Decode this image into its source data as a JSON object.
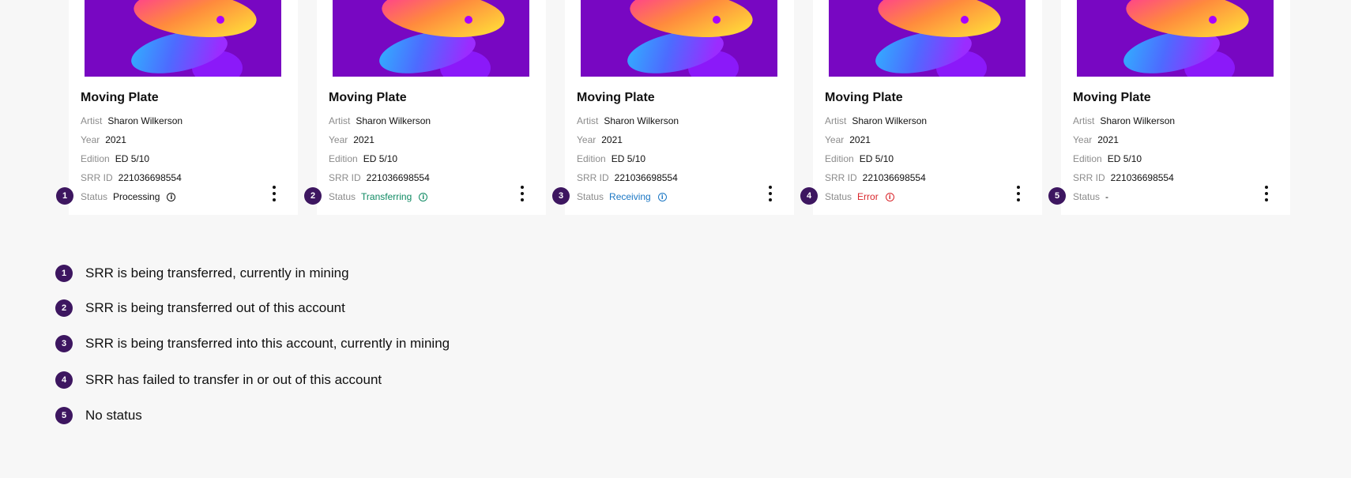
{
  "colors": {
    "background": "#f7f7f7",
    "card": "#ffffff",
    "badge": "#3d1660",
    "processing": "#111111",
    "transferring": "#0f8a63",
    "receiving": "#1b77c4",
    "error": "#d9262b",
    "none": "#111111"
  },
  "labels": {
    "artist": "Artist",
    "year": "Year",
    "edition": "Edition",
    "srr_id": "SRR ID",
    "status": "Status"
  },
  "cards": [
    {
      "badge": "1",
      "title": "Moving Plate",
      "artist": "Sharon Wilkerson",
      "year": "2021",
      "edition": "ED 5/10",
      "srr_id": "221036698554",
      "status": "Processing",
      "status_color": "#111111",
      "info_icon": true
    },
    {
      "badge": "2",
      "title": "Moving Plate",
      "artist": "Sharon Wilkerson",
      "year": "2021",
      "edition": "ED 5/10",
      "srr_id": "221036698554",
      "status": "Transferring",
      "status_color": "#0f8a63",
      "info_icon": true
    },
    {
      "badge": "3",
      "title": "Moving Plate",
      "artist": "Sharon Wilkerson",
      "year": "2021",
      "edition": "ED 5/10",
      "srr_id": "221036698554",
      "status": "Receiving",
      "status_color": "#1b77c4",
      "info_icon": true
    },
    {
      "badge": "4",
      "title": "Moving Plate",
      "artist": "Sharon Wilkerson",
      "year": "2021",
      "edition": "ED 5/10",
      "srr_id": "221036698554",
      "status": "Error",
      "status_color": "#d9262b",
      "info_icon": true
    },
    {
      "badge": "5",
      "title": "Moving Plate",
      "artist": "Sharon Wilkerson",
      "year": "2021",
      "edition": "ED 5/10",
      "srr_id": "221036698554",
      "status": "-",
      "status_color": "#111111",
      "info_icon": false
    }
  ],
  "legend": [
    {
      "badge": "1",
      "text": "SRR is being transferred, currently in mining"
    },
    {
      "badge": "2",
      "text": "SRR is being transferred out of this account"
    },
    {
      "badge": "3",
      "text": "SRR is being transferred into this account, currently in mining"
    },
    {
      "badge": "4",
      "text": "SRR has failed to transfer in or out of this account"
    },
    {
      "badge": "5",
      "text": "No status"
    }
  ]
}
